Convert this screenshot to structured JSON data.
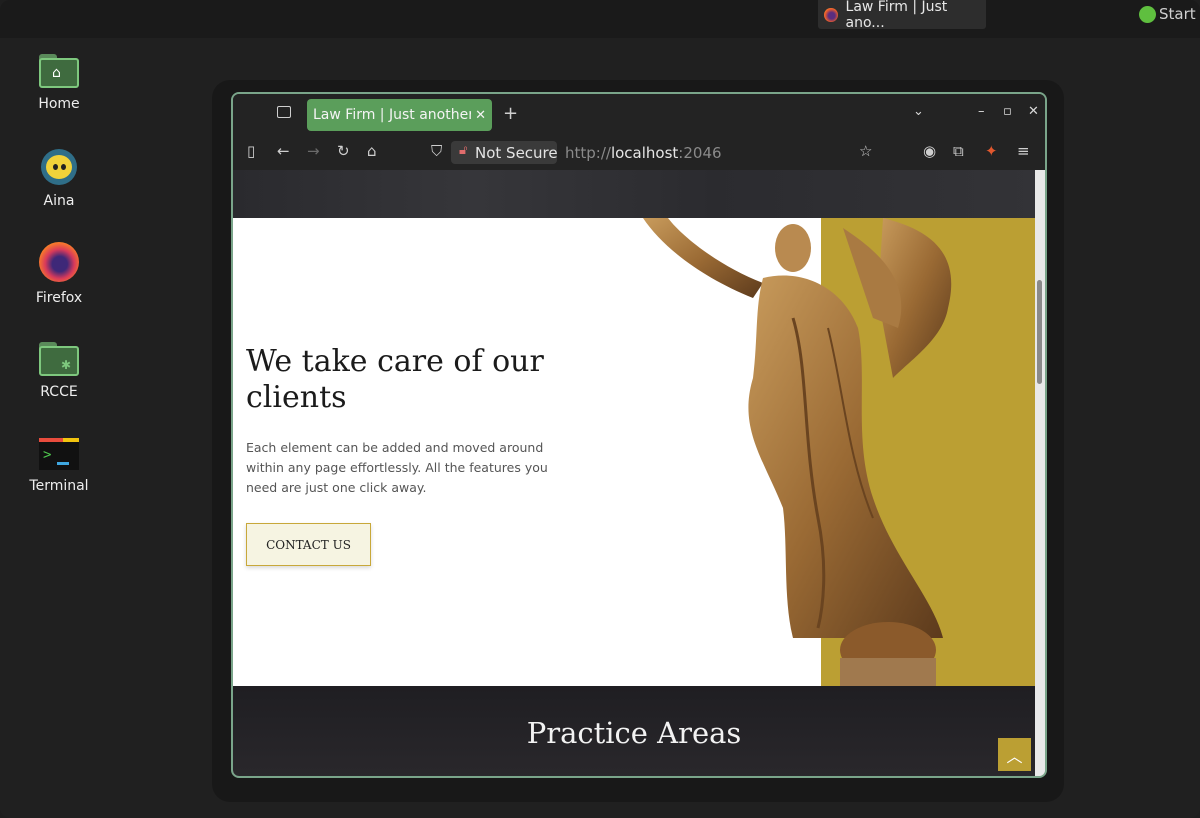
{
  "taskbar": {
    "window_title": "Law Firm | Just ano...",
    "start_label": "Start",
    "start_color": "#5fbf3f"
  },
  "desktop_icons": [
    {
      "label": "Home",
      "icon": "home-folder-icon"
    },
    {
      "label": "Aina",
      "icon": "aina-icon"
    },
    {
      "label": "Firefox",
      "icon": "firefox-icon"
    },
    {
      "label": "RCCE",
      "icon": "rcce-folder-icon"
    },
    {
      "label": "Terminal",
      "icon": "terminal-icon"
    }
  ],
  "browser": {
    "tab_title": "Law Firm | Just another",
    "tab_color": "#5b9e5b",
    "security_label": "Not Secure",
    "url_prefix": "http://",
    "url_host": "localhost",
    "url_port": ":2046"
  },
  "page": {
    "hero_heading": "We take care of our clients",
    "hero_text": "Each element can be added and moved around within any page effortlessly. All the features you need are just one click away.",
    "contact_button": "CONTACT US",
    "section_heading": "Practice Areas",
    "accent_color": "#bb9f33"
  }
}
